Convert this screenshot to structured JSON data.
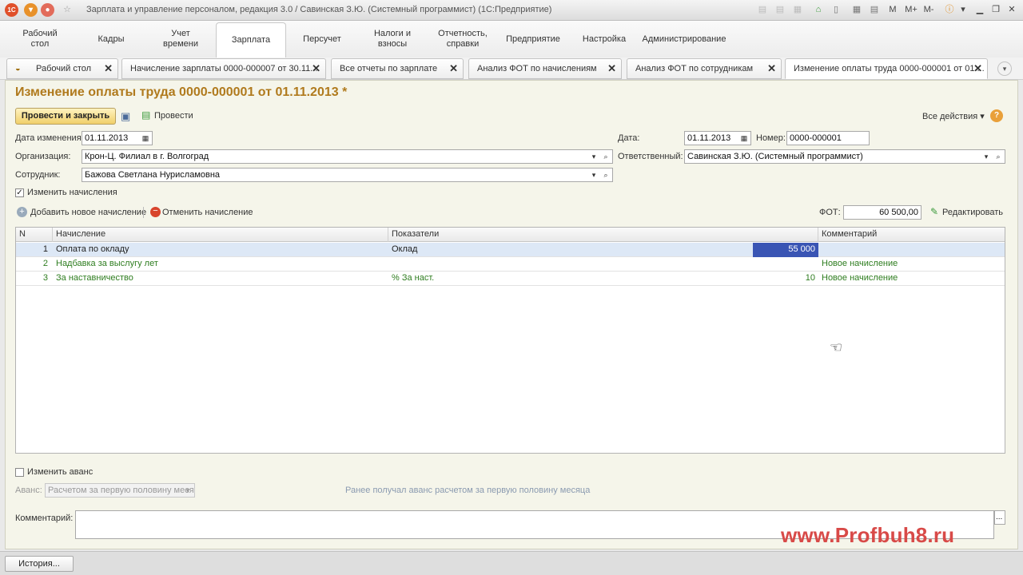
{
  "window": {
    "title": "Зарплата и управление персоналом, редакция 3.0 / Савинская З.Ю. (Системный программист) (1С:Предприятие)",
    "logo": "1С",
    "toolbar": {
      "m": "M",
      "m_plus": "M+",
      "m_minus": "M-"
    }
  },
  "menu": [
    {
      "label": "Рабочий\nстол"
    },
    {
      "label": "Кадры"
    },
    {
      "label": "Учет\nвремени"
    },
    {
      "label": "Зарплата"
    },
    {
      "label": "Персучет"
    },
    {
      "label": "Налоги и\nвзносы"
    },
    {
      "label": "Отчетность,\nсправки"
    },
    {
      "label": "Предприятие"
    },
    {
      "label": "Настройка"
    },
    {
      "label": "Администрирование"
    }
  ],
  "tabs": [
    {
      "label": "Рабочий стол"
    },
    {
      "label": "Начисление зарплаты 0000-000007 от 30.11...."
    },
    {
      "label": "Все отчеты по зарплате"
    },
    {
      "label": "Анализ ФОТ по начислениям"
    },
    {
      "label": "Анализ ФОТ по сотрудникам"
    },
    {
      "label": "Изменение оплаты труда 0000-000001 от 01...."
    }
  ],
  "doc": {
    "title": "Изменение оплаты труда 0000-000001 от 01.11.2013 *",
    "post_close": "Провести и закрыть",
    "post": "Провести",
    "all_actions": "Все действия",
    "help": "?",
    "change_date_label": "Дата изменения:",
    "change_date": "01.11.2013",
    "date_label": "Дата:",
    "date": "01.11.2013",
    "number_label": "Номер:",
    "number": "0000-000001",
    "org_label": "Организация:",
    "org": "Крон-Ц. Филиал в г. Волгоград",
    "responsible_label": "Ответственный:",
    "responsible": "Савинская З.Ю. (Системный программист)",
    "employee_label": "Сотрудник:",
    "employee": "Бажова Светлана Нурисламовна",
    "change_accruals": "Изменить начисления",
    "add_accrual": "Добавить новое начисление",
    "cancel_accrual": "Отменить начисление",
    "fot_label": "ФОТ:",
    "fot": "60 500,00",
    "edit": "Редактировать"
  },
  "grid": {
    "headers": {
      "n": "N",
      "accrual": "Начисление",
      "indicators": "Показатели",
      "comment": "Комментарий"
    },
    "rows": [
      {
        "n": "1",
        "accrual": "Оплата по окладу",
        "indicator": "Оклад",
        "value": "55 000",
        "comment": ""
      },
      {
        "n": "2",
        "accrual": "Надбавка за выслугу лет",
        "indicator": "",
        "value": "",
        "comment": "Новое начисление"
      },
      {
        "n": "3",
        "accrual": "За наставничество",
        "indicator": "%  За наст.",
        "value": "10",
        "comment": "Новое начисление"
      }
    ]
  },
  "advance": {
    "change_label": "Изменить аванс",
    "label": "Аванс:",
    "value": "Расчетом за первую половину меся",
    "note": "Ранее получал аванс расчетом за первую половину месяца"
  },
  "comment": {
    "label": "Комментарий:",
    "value": "",
    "button": "..."
  },
  "footer": {
    "history": "История..."
  },
  "watermark": "www.Profbuh8.ru"
}
